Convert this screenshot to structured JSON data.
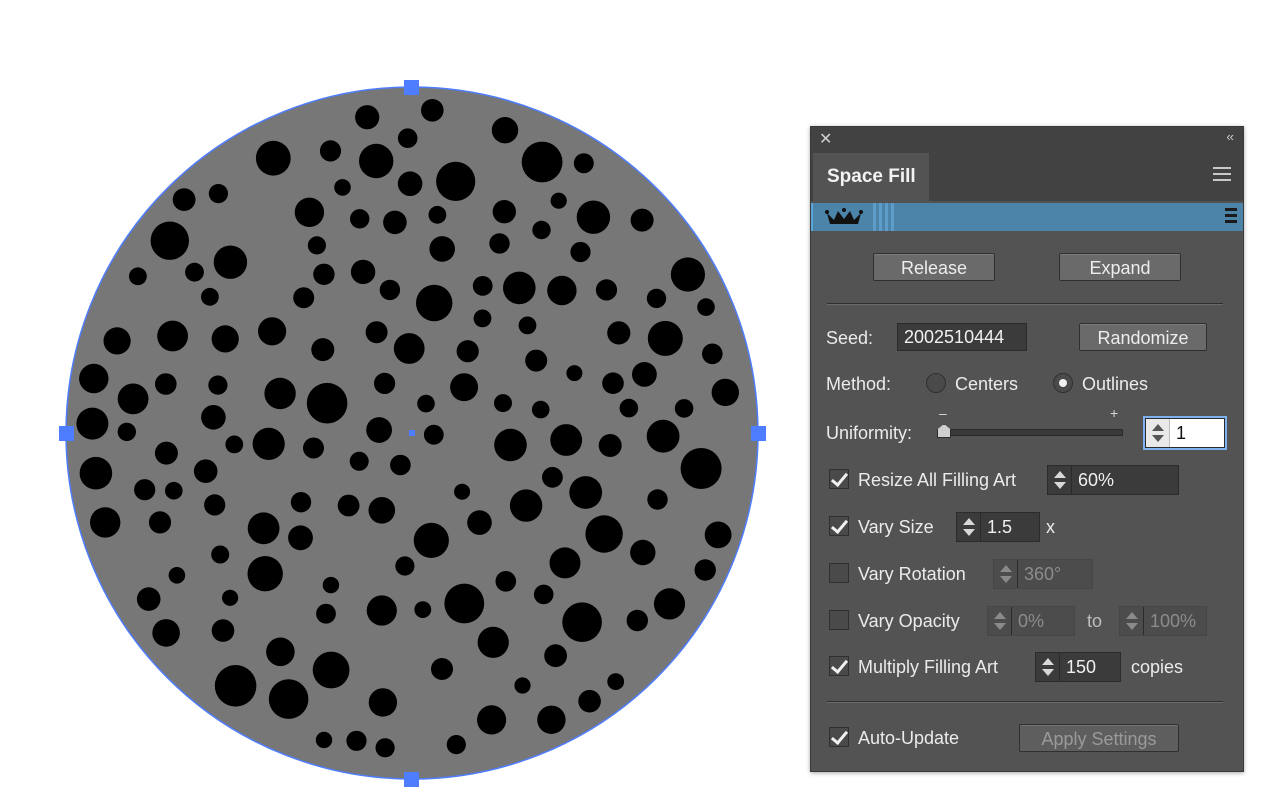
{
  "panel": {
    "title": "Space Fill",
    "brand_icon": "crown-icon",
    "buttons": {
      "release": "Release",
      "expand": "Expand",
      "randomize": "Randomize",
      "apply": "Apply Settings"
    },
    "seed": {
      "label": "Seed:",
      "value": "2002510444"
    },
    "method": {
      "label": "Method:",
      "options": [
        "Centers",
        "Outlines"
      ],
      "selected": "Outlines"
    },
    "uniformity": {
      "label": "Uniformity:",
      "minus": "–",
      "plus": "+",
      "value": "1",
      "level": 0
    },
    "resize": {
      "label": "Resize All Filling Art",
      "checked": true,
      "value": "60%"
    },
    "vary_size": {
      "label": "Vary Size",
      "checked": true,
      "value": "1.5",
      "unit": "x"
    },
    "vary_rotation": {
      "label": "Vary Rotation",
      "checked": false,
      "value": "360°"
    },
    "vary_opacity": {
      "label": "Vary Opacity",
      "checked": false,
      "from": "0%",
      "to_label": "to",
      "to": "100%"
    },
    "multiply": {
      "label": "Multiply Filling Art",
      "checked": true,
      "value": "150",
      "unit": "copies"
    },
    "auto_update": {
      "label": "Auto-Update",
      "checked": true
    }
  },
  "artwork": {
    "fill_color": "#777777",
    "dot_color": "#000000",
    "selection_color": "#4e7dff",
    "dot_count": 150
  }
}
